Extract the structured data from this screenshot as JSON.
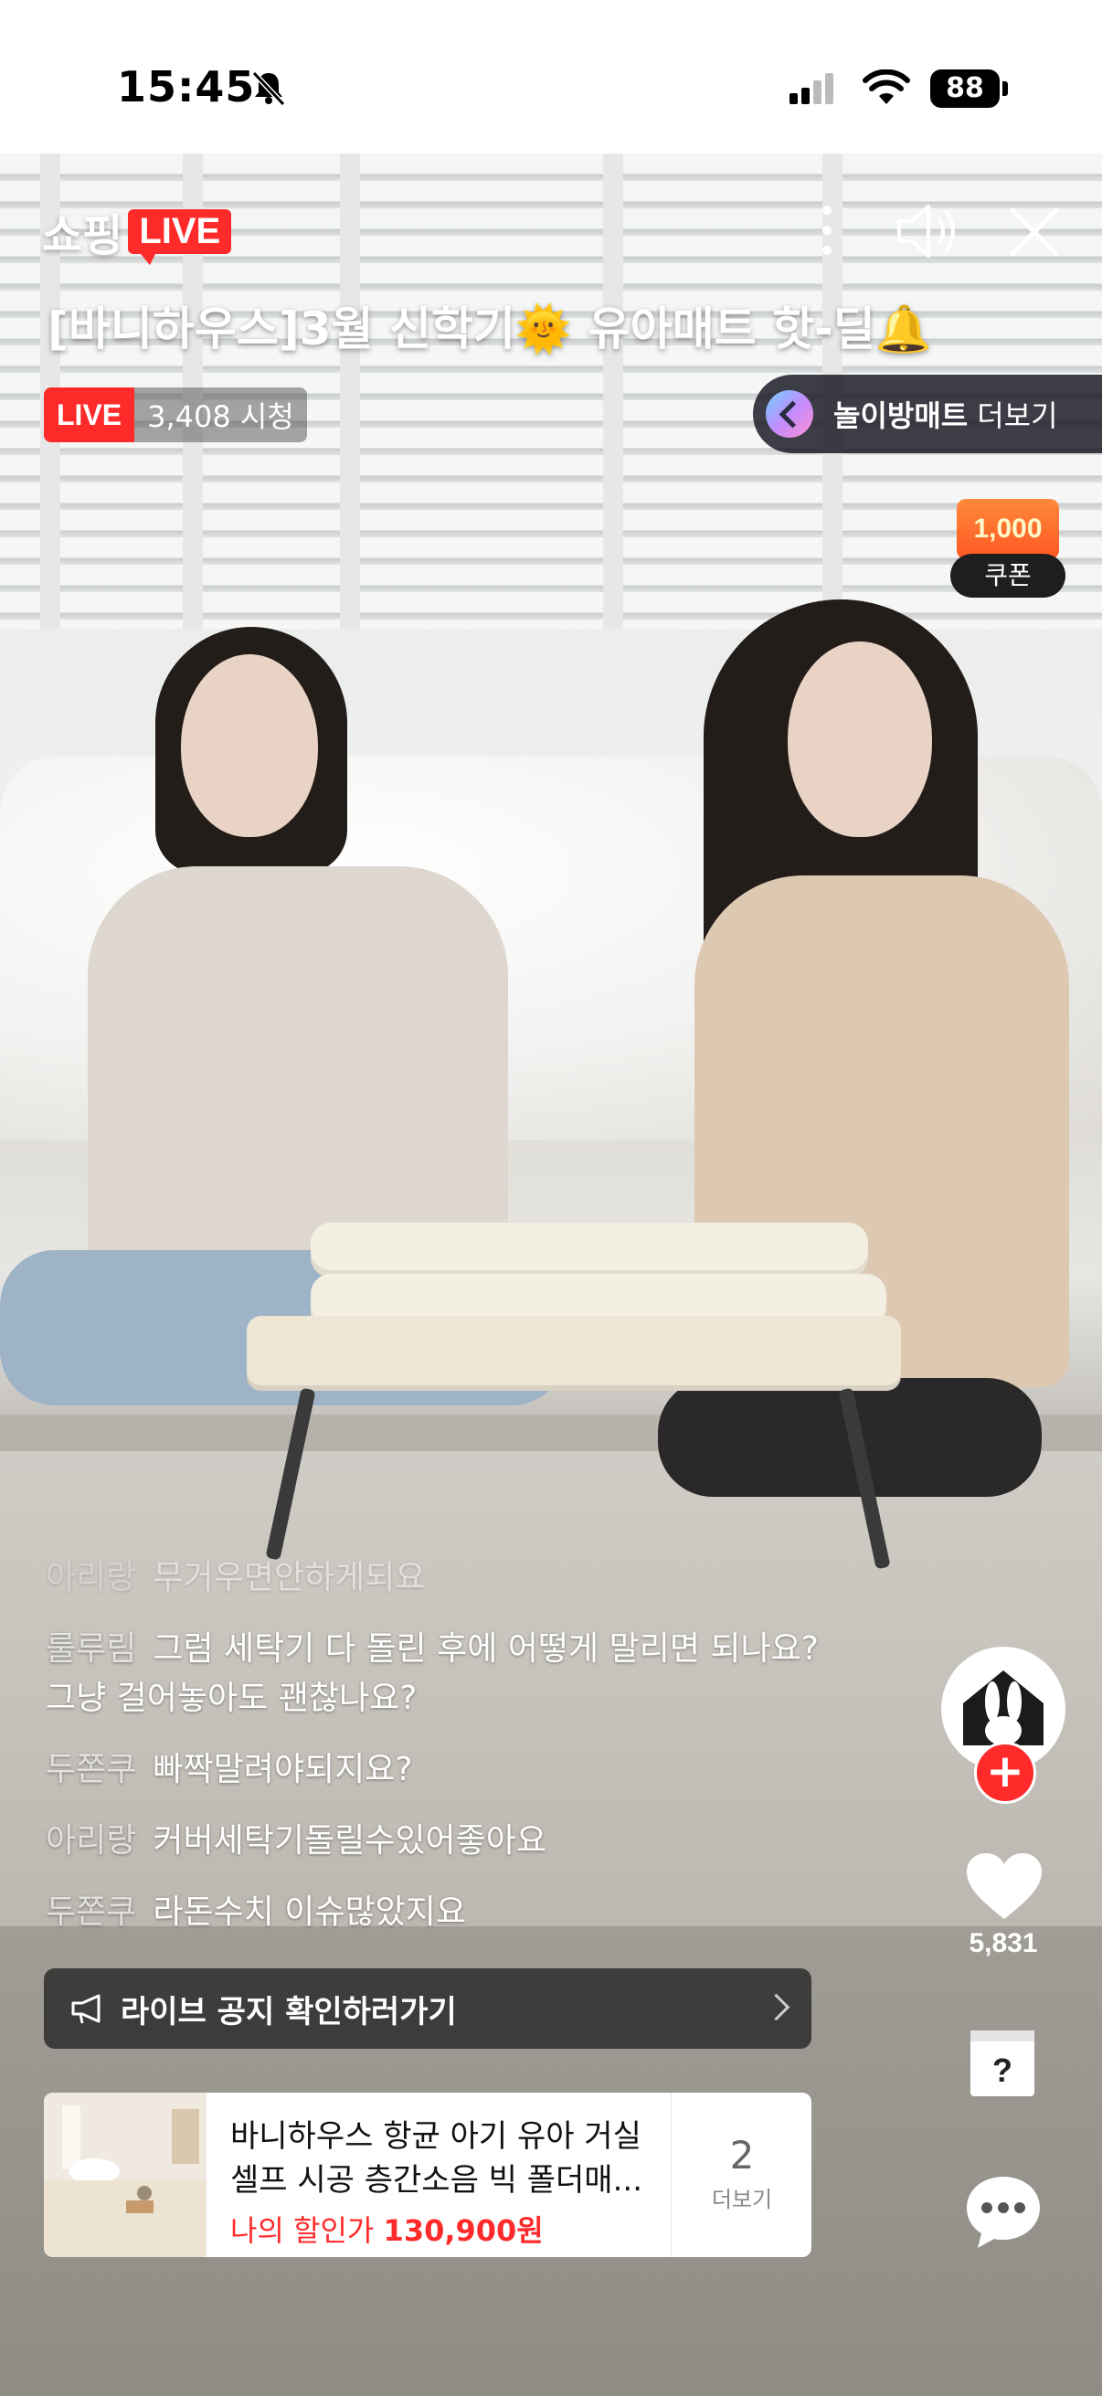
{
  "status_bar": {
    "time": "15:45",
    "battery": "88"
  },
  "header": {
    "brand": "쇼핑",
    "brand_live": "LIVE",
    "title": "[바니하우스]3월 신학기🌞 유아매트 핫-딜🔔",
    "live_badge": "LIVE",
    "viewers": "3,408 시청",
    "category_label": "놀이방매트",
    "category_more": "더보기"
  },
  "coupon": {
    "amount": "1,000",
    "label": "쿠폰"
  },
  "chat": [
    {
      "nick": "아리랑",
      "text": "무거우면안하게되요",
      "faded": true
    },
    {
      "nick": "룰루림",
      "text": "그럼 세탁기 다 돌린 후에 어떻게 말리면 되나요? 그냥 걸어놓아도 괜찮나요?",
      "faded": false
    },
    {
      "nick": "두쫀쿠",
      "text": "빠짝말려야되지요?",
      "faded": false
    },
    {
      "nick": "아리랑",
      "text": "커버세탁기돌릴수있어좋아요",
      "faded": false
    },
    {
      "nick": "두쫀쿠",
      "text": "라돈수치 이슈많았지요",
      "faded": false
    }
  ],
  "notice": {
    "text": "라이브 공지 확인하러가기"
  },
  "product": {
    "name": "바니하우스 항균 아기 유아 거실 셀프 시공 층간소음 빅 폴더매...",
    "price_label": "나의 할인가",
    "price": "130,900원",
    "count": "2",
    "more": "더보기"
  },
  "rail": {
    "likes": "5,831"
  },
  "colors": {
    "accent": "#ff2b2b",
    "coupon": "#ff5722"
  },
  "icons": [
    "bell-slash-icon",
    "signal-icon",
    "wifi-icon",
    "more-vertical-icon",
    "speaker-icon",
    "close-icon",
    "chevron-left-icon",
    "megaphone-icon",
    "chevron-right-icon",
    "bunny-house-icon",
    "plus-icon",
    "heart-icon",
    "question-box-icon",
    "chat-bubble-icon"
  ]
}
